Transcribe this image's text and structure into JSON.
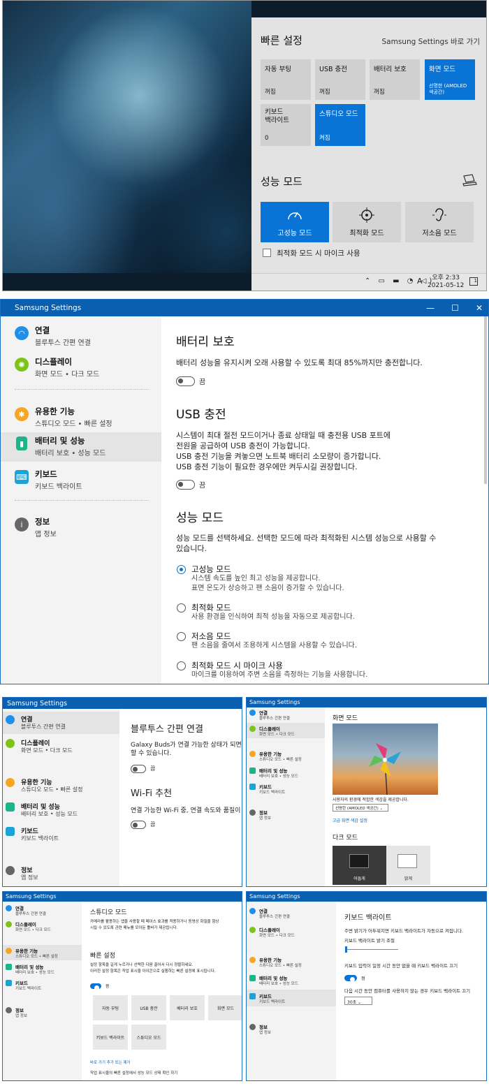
{
  "quick_settings": {
    "title": "빠른 설정",
    "link": "Samsung Settings 바로 가기",
    "tiles": [
      {
        "label": "자동 부팅",
        "status": "꺼짐",
        "on": false
      },
      {
        "label": "USB 충전",
        "status": "꺼짐",
        "on": false
      },
      {
        "label": "배터리 보호",
        "status": "꺼짐",
        "on": false
      },
      {
        "label": "화면 모드",
        "status": "선명한 (AMOLED 색공간)",
        "on": true
      },
      {
        "label": "키보드\n백라이트",
        "status": "0",
        "on": false
      },
      {
        "label": "스튜디오 모드",
        "status": "켜짐",
        "on": true
      }
    ],
    "perf_title": "성능 모드",
    "perf_modes": [
      {
        "label": "고성능 모드",
        "icon": "speedometer-icon",
        "on": true
      },
      {
        "label": "최적화 모드",
        "icon": "crosshair-icon",
        "on": false
      },
      {
        "label": "저소음 모드",
        "icon": "ear-icon",
        "on": false
      }
    ],
    "mic_checkbox": "최적화 모드 시 마이크 사용",
    "clock_time": "오후 2:33",
    "clock_date": "2021-05-12",
    "tray_lang": "A",
    "notif_count": "1"
  },
  "window": {
    "title": "Samsung Settings",
    "nav": [
      {
        "title": "연결",
        "sub": "블루투스 간편 연결",
        "color": "#1e90e8",
        "icon": "wifi-icon"
      },
      {
        "title": "디스플레이",
        "sub": "화면 모드 • 다크 모드",
        "color": "#7cc418",
        "icon": "sun-icon"
      },
      {
        "title": "유용한 기능",
        "sub": "스튜디오 모드 • 빠른 설정",
        "color": "#f5a623",
        "icon": "gear-icon"
      },
      {
        "title": "배터리 및 성능",
        "sub": "배터리 보호 • 성능 모드",
        "color": "#1bb58a",
        "icon": "battery-icon"
      },
      {
        "title": "키보드",
        "sub": "키보드 백라이트",
        "color": "#1ba3d6",
        "icon": "keyboard-icon"
      },
      {
        "title": "정보",
        "sub": "앱 정보",
        "color": "#666666",
        "icon": "info-icon"
      }
    ],
    "battery": {
      "title": "배터리 보호",
      "desc": "배터리 성능을 유지시켜 오래 사용할 수 있도록 최대 85%까지만 충전합니다.",
      "toggle": "끔"
    },
    "usb": {
      "title": "USB 충전",
      "desc": [
        "시스템이 최대 절전 모드이거나 종료 상태일 때 충전용 USB 포트에",
        "전원을 공급하여 USB 충전이 가능합니다.",
        "USB 충전 기능을 켜놓으면 노트북 배터리 소모량이 증가합니다.",
        "USB 충전 기능이 필요한 경우에만 켜두시길 권장합니다."
      ],
      "toggle": "끔"
    },
    "perf": {
      "title": "성능 모드",
      "desc": [
        "성능 모드를 선택하세요. 선택한 모드에 따라 최적화된 시스템 성능으로 사용할 수",
        "있습니다."
      ],
      "options": [
        {
          "label": "고성능 모드",
          "desc": [
            "시스템 속도를 높인 최고 성능을 제공합니다.",
            "표면 온도가 상승하고 팬 소음이 증가할 수 있습니다."
          ],
          "on": true
        },
        {
          "label": "최적화 모드",
          "desc": [
            "사용 환경을 인식하여 최적 성능을 자동으로 제공합니다."
          ],
          "on": false
        },
        {
          "label": "저소음 모드",
          "desc": [
            "팬 소음을 줄여서 조용하게 시스템을 사용할 수 있습니다."
          ],
          "on": false
        },
        {
          "label": "최적화 모드 시 마이크 사용",
          "desc": [
            "마이크를 이용하여 주변 소음을 측정하는 기능을 사용합니다."
          ],
          "on": false
        }
      ]
    }
  },
  "thumb1": {
    "title": "Samsung Settings",
    "bt_title": "블루투스 간편 연결",
    "bt_desc": [
      "Galaxy Buds가 연결 가능한 상태가 되면 P",
      "할 수 있습니다."
    ],
    "bt_toggle": "끔",
    "wifi_title": "Wi-Fi 추천",
    "wifi_desc": "연결 가능한 Wi-Fi 중, 연결 속도와 품질이",
    "wifi_toggle": "끔"
  },
  "thumb2": {
    "title": "Samsung Settings",
    "screen_title": "화면 모드",
    "screen_desc": "사용자의 환경에 적합한 색감을 제공합니다.",
    "select": "선명한 (AMOLED 색공간)",
    "advanced": "고급 화면 색감 설정",
    "dark_title": "다크 모드",
    "dark": "어둡게",
    "light": "밝게"
  },
  "thumb3": {
    "title": "Samsung Settings",
    "studio_title": "스튜디오 모드",
    "studio_desc": [
      "카메라를 활용하는 앱을 사용할 때 페이스 효과를 적용하거나 동영상 화질을 향상",
      "시킬 수 있도록 관련 메뉴를 모아둔 툴바가 제공됩니다."
    ],
    "quick_title": "빠른 설정",
    "quick_desc": [
      "설정 항목을 길게 누르거나 선택한 다음 끌어서 다시 정렬하세요.",
      "이러한 설정 항목은 작업 표시줄 아이콘으로 실행하는 빠른 설정에 표시됩니다."
    ],
    "quick_toggle": "켬",
    "tiles": [
      "자동 부팅",
      "USB 충전",
      "배터리 보호",
      "화면 모드",
      "키보드 백라이트",
      "스튜디오 모드"
    ],
    "link": "바로 가기 추가 또는 제거",
    "footer": "작업 표시줄의 빠른 설정에서 성능 모드 상태 확인 하기"
  },
  "thumb4": {
    "title": "Samsung Settings",
    "kb_title": "키보드 백라이트",
    "kb_desc": "주변 밝기가 어두워지면 키보드 백라이트가 자동으로 켜집니다.",
    "kb_brightness": "키보드 백라이트 밝기 조절",
    "kb_auto": "키보드 입력이 일정 시간 동안 없을 때 키보드 백라이트 끄기",
    "kb_toggle": "켬",
    "kb_idle": "다음 시간 동안 컴퓨터를 사용하지 않는 경우 키보드 백라이트 끄기",
    "kb_select": "30초"
  }
}
